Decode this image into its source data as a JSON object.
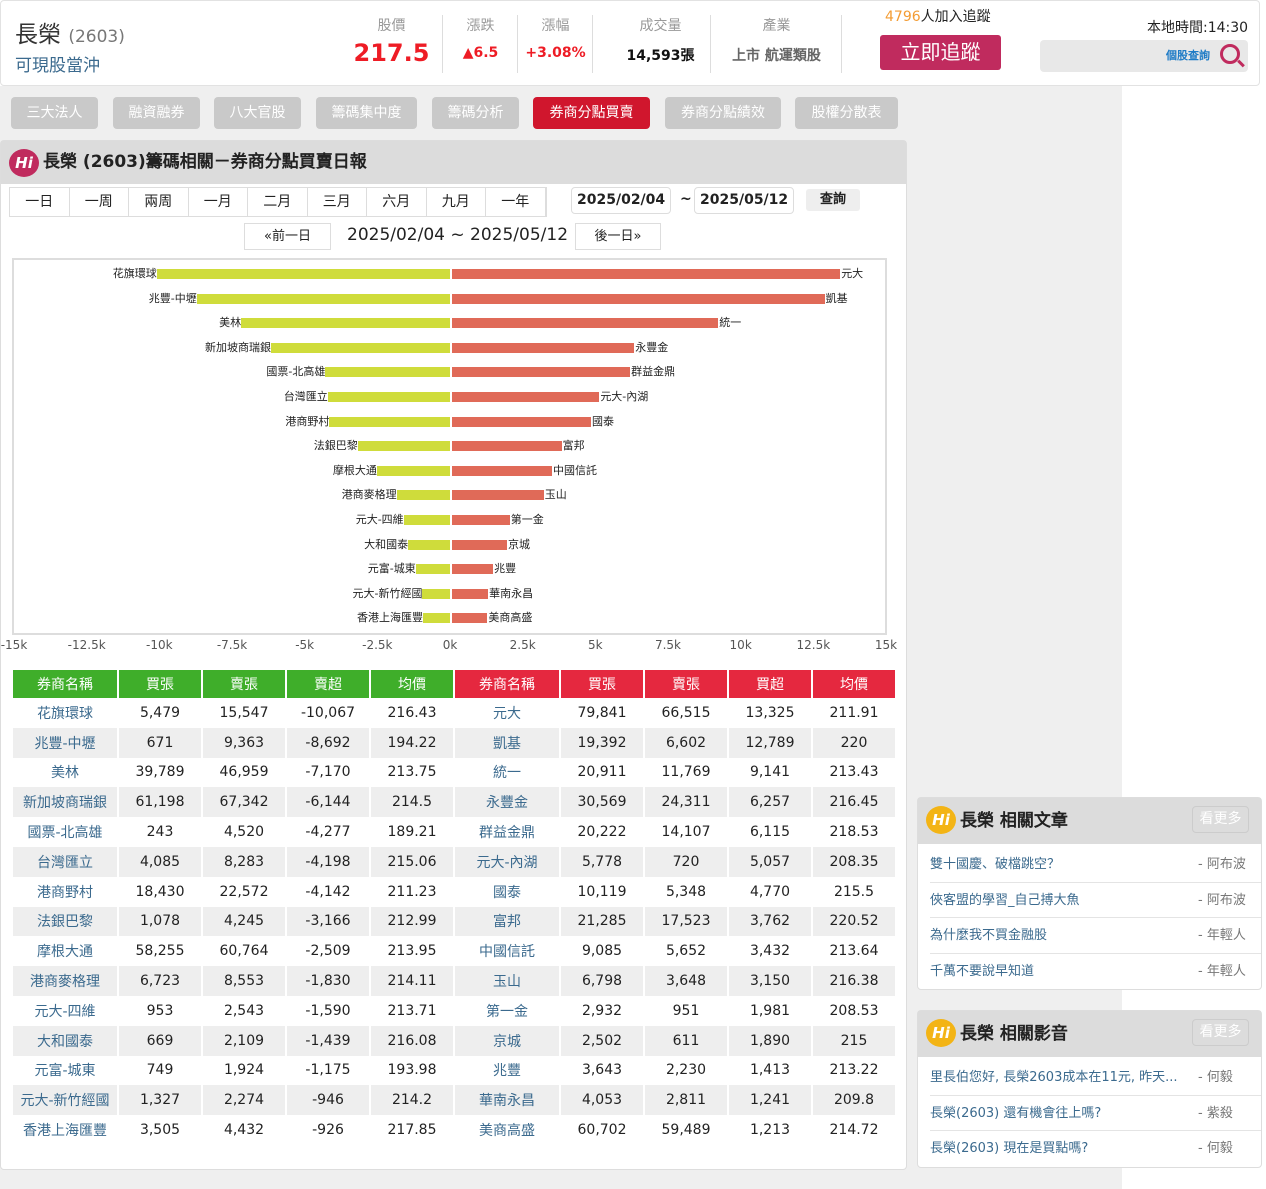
{
  "header": {
    "name": "長榮",
    "code": "(2603)",
    "sub": "可現股當沖",
    "stats": [
      {
        "label": "股價",
        "value": "217.5",
        "color": "#ee1c25"
      },
      {
        "label": "漲跌",
        "value": "▲6.5",
        "color": "#ee1c25"
      },
      {
        "label": "漲幅",
        "value": "+3.08%",
        "color": "#ee1c25"
      },
      {
        "label": "成交量",
        "value": "14,593張",
        "color": "#111111"
      },
      {
        "label": "產業",
        "value": "上市 航運類股",
        "color": "#666666"
      }
    ],
    "followers": "4796",
    "followers_text": "人加入追蹤",
    "follow_btn": "立即追蹤",
    "local_time": "本地時間:14:30",
    "search_label": "個股查詢"
  },
  "tabs": [
    "三大法人",
    "融資融券",
    "八大官股",
    "籌碼集中度",
    "籌碼分析",
    "券商分點買賣",
    "券商分點績效",
    "股權分散表"
  ],
  "panel": {
    "title": "長榮 (2603)籌碼相關－券商分點買賣日報",
    "hi": "Hi",
    "periods": [
      "一日",
      "一周",
      "兩周",
      "一月",
      "二月",
      "三月",
      "六月",
      "九月",
      "一年"
    ],
    "date_from": "2025/02/04",
    "tilde": "~",
    "date_to": "2025/05/12",
    "query": "查詢",
    "prev": "«前一日",
    "next": "後一日»",
    "range": "2025/02/04 ~ 2025/05/12"
  },
  "chart_data": {
    "type": "bar",
    "orientation": "horizontal-diverging",
    "xlim": [
      -15000,
      15000
    ],
    "ticks": [
      "-15k",
      "-12.5k",
      "-10k",
      "-7.5k",
      "-5k",
      "-2.5k",
      "0k",
      "2.5k",
      "5k",
      "7.5k",
      "10k",
      "12.5k",
      "15k"
    ],
    "sell_color": "#cfdc3b",
    "buy_color": "#e06a58"
  },
  "table": {
    "sell_headers": [
      "券商名稱",
      "買張",
      "賣張",
      "賣超",
      "均價"
    ],
    "buy_headers": [
      "券商名稱",
      "買張",
      "賣張",
      "買超",
      "均價"
    ],
    "sell_color": "#3fae2a",
    "buy_color": "#e5283f",
    "sell": [
      [
        "花旗環球",
        "5,479",
        "15,547",
        "-10,067",
        "216.43"
      ],
      [
        "兆豐-中壢",
        "671",
        "9,363",
        "-8,692",
        "194.22"
      ],
      [
        "美林",
        "39,789",
        "46,959",
        "-7,170",
        "213.75"
      ],
      [
        "新加坡商瑞銀",
        "61,198",
        "67,342",
        "-6,144",
        "214.5"
      ],
      [
        "國票-北高雄",
        "243",
        "4,520",
        "-4,277",
        "189.21"
      ],
      [
        "台灣匯立",
        "4,085",
        "8,283",
        "-4,198",
        "215.06"
      ],
      [
        "港商野村",
        "18,430",
        "22,572",
        "-4,142",
        "211.23"
      ],
      [
        "法銀巴黎",
        "1,078",
        "4,245",
        "-3,166",
        "212.99"
      ],
      [
        "摩根大通",
        "58,255",
        "60,764",
        "-2,509",
        "213.95"
      ],
      [
        "港商麥格理",
        "6,723",
        "8,553",
        "-1,830",
        "214.11"
      ],
      [
        "元大-四維",
        "953",
        "2,543",
        "-1,590",
        "213.71"
      ],
      [
        "大和國泰",
        "669",
        "2,109",
        "-1,439",
        "216.08"
      ],
      [
        "元富-城東",
        "749",
        "1,924",
        "-1,175",
        "193.98"
      ],
      [
        "元大-新竹經國",
        "1,327",
        "2,274",
        "-946",
        "214.2"
      ],
      [
        "香港上海匯豐",
        "3,505",
        "4,432",
        "-926",
        "217.85"
      ]
    ],
    "buy": [
      [
        "元大",
        "79,841",
        "66,515",
        "13,325",
        "211.91"
      ],
      [
        "凱基",
        "19,392",
        "6,602",
        "12,789",
        "220"
      ],
      [
        "統一",
        "20,911",
        "11,769",
        "9,141",
        "213.43"
      ],
      [
        "永豐金",
        "30,569",
        "24,311",
        "6,257",
        "216.45"
      ],
      [
        "群益金鼎",
        "20,222",
        "14,107",
        "6,115",
        "218.53"
      ],
      [
        "元大-內湖",
        "5,778",
        "720",
        "5,057",
        "208.35"
      ],
      [
        "國泰",
        "10,119",
        "5,348",
        "4,770",
        "215.5"
      ],
      [
        "富邦",
        "21,285",
        "17,523",
        "3,762",
        "220.52"
      ],
      [
        "中國信託",
        "9,085",
        "5,652",
        "3,432",
        "213.64"
      ],
      [
        "玉山",
        "6,798",
        "3,648",
        "3,150",
        "216.38"
      ],
      [
        "第一金",
        "2,932",
        "951",
        "1,981",
        "208.53"
      ],
      [
        "京城",
        "2,502",
        "611",
        "1,890",
        "215"
      ],
      [
        "兆豐",
        "3,643",
        "2,230",
        "1,413",
        "213.22"
      ],
      [
        "華南永昌",
        "4,053",
        "2,811",
        "1,241",
        "209.8"
      ],
      [
        "美商高盛",
        "60,702",
        "59,489",
        "1,213",
        "214.72"
      ]
    ]
  },
  "articles": {
    "title": "長榮 相關文章",
    "more": "看更多",
    "items": [
      {
        "t": "雙十國慶、破檔跳空？",
        "a": "- 阿布波"
      },
      {
        "t": "俠客盟的學習_自己搏大魚",
        "a": "- 阿布波"
      },
      {
        "t": "為什麼我不買金融股",
        "a": "- 年輕人"
      },
      {
        "t": "千萬不要說早知道",
        "a": "- 年輕人"
      }
    ]
  },
  "videos": {
    "title": "長榮 相關影音",
    "more": "看更多",
    "items": [
      {
        "t": "里長伯您好, 長榮2603成本在11元, 昨天...",
        "a": "- 何毅"
      },
      {
        "t": "長榮(2603) 還有機會往上嗎?",
        "a": "- 紫殺"
      },
      {
        "t": "長榮(2603) 現在是買點嗎?",
        "a": "- 何毅"
      }
    ]
  }
}
